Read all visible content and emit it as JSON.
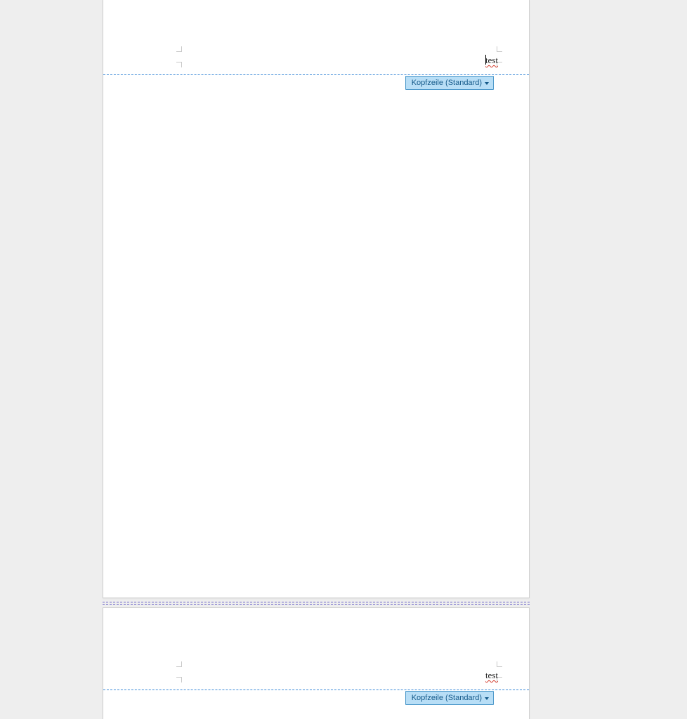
{
  "header": {
    "text": "test",
    "pill_label": "Kopfzeile (Standard)"
  },
  "page2_header": {
    "text": "test",
    "pill_label": "Kopfzeile (Standard)"
  }
}
